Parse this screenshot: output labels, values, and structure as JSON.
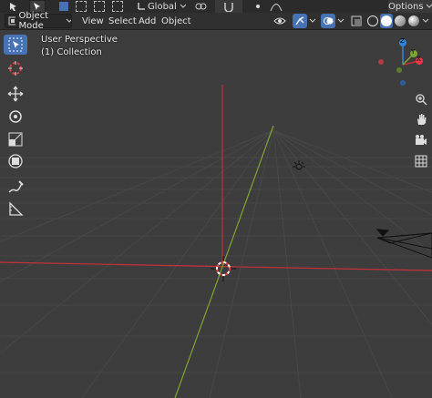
{
  "topbar": {
    "options_label": "Options",
    "orientation_label": "Global"
  },
  "header": {
    "mode_label": "Object Mode",
    "menus": [
      "View",
      "Select",
      "Add",
      "Object"
    ]
  },
  "viewport": {
    "perspective_label": "User Perspective",
    "collection_label": "(1) Collection"
  },
  "gizmo": {
    "x_label": "X",
    "y_label": "Y",
    "z_label": "Z"
  },
  "colors": {
    "accent": "#4772b3",
    "x_axis": "#c8303a",
    "y_axis": "#7fa531",
    "z_axis": "#2f86d9",
    "grid": "#474747",
    "background": "#3d3d3d"
  }
}
